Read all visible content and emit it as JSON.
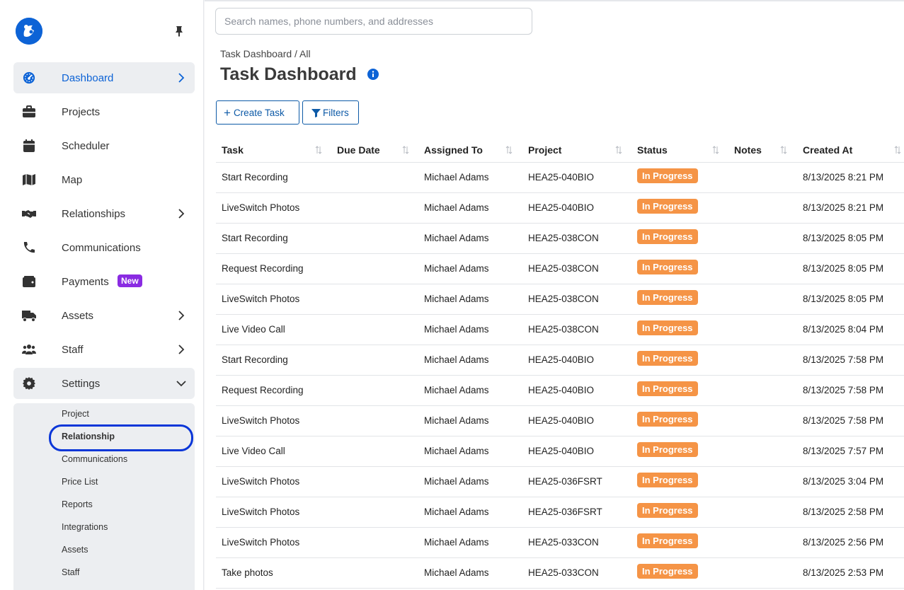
{
  "search": {
    "placeholder": "Search names, phone numbers, and addresses"
  },
  "breadcrumb": "Task Dashboard / All",
  "page_title": "Task Dashboard",
  "buttons": {
    "create_task": "Create Task",
    "filters": "Filters"
  },
  "nav": [
    {
      "label": "Dashboard",
      "icon": "dashboard-gauge-icon",
      "chevron": "right",
      "active": true
    },
    {
      "label": "Projects",
      "icon": "briefcase-icon"
    },
    {
      "label": "Scheduler",
      "icon": "calendar-icon"
    },
    {
      "label": "Map",
      "icon": "map-icon"
    },
    {
      "label": "Relationships",
      "icon": "handshake-icon",
      "chevron": "right"
    },
    {
      "label": "Communications",
      "icon": "phone-icon"
    },
    {
      "label": "Payments",
      "icon": "wallet-icon",
      "badge": "New"
    },
    {
      "label": "Assets",
      "icon": "truck-icon",
      "chevron": "right"
    },
    {
      "label": "Staff",
      "icon": "users-icon",
      "chevron": "right"
    },
    {
      "label": "Settings",
      "icon": "gear-icon",
      "chevron": "down"
    }
  ],
  "settings_sub": [
    "Project",
    "Relationship",
    "Communications",
    "Price List",
    "Reports",
    "Integrations",
    "Assets",
    "Staff"
  ],
  "settings_sub_active": "Relationship",
  "table": {
    "columns": [
      "Task",
      "Due Date",
      "Assigned To",
      "Project",
      "Status",
      "Notes",
      "Created At"
    ],
    "rows": [
      [
        "Start Recording",
        "",
        "Michael Adams",
        "HEA25-040BIO",
        "In Progress",
        "",
        "8/13/2025 8:21 PM"
      ],
      [
        "LiveSwitch Photos",
        "",
        "Michael Adams",
        "HEA25-040BIO",
        "In Progress",
        "",
        "8/13/2025 8:21 PM"
      ],
      [
        "Start Recording",
        "",
        "Michael Adams",
        "HEA25-038CON",
        "In Progress",
        "",
        "8/13/2025 8:05 PM"
      ],
      [
        "Request Recording",
        "",
        "Michael Adams",
        "HEA25-038CON",
        "In Progress",
        "",
        "8/13/2025 8:05 PM"
      ],
      [
        "LiveSwitch Photos",
        "",
        "Michael Adams",
        "HEA25-038CON",
        "In Progress",
        "",
        "8/13/2025 8:05 PM"
      ],
      [
        "Live Video Call",
        "",
        "Michael Adams",
        "HEA25-038CON",
        "In Progress",
        "",
        "8/13/2025 8:04 PM"
      ],
      [
        "Start Recording",
        "",
        "Michael Adams",
        "HEA25-040BIO",
        "In Progress",
        "",
        "8/13/2025 7:58 PM"
      ],
      [
        "Request Recording",
        "",
        "Michael Adams",
        "HEA25-040BIO",
        "In Progress",
        "",
        "8/13/2025 7:58 PM"
      ],
      [
        "LiveSwitch Photos",
        "",
        "Michael Adams",
        "HEA25-040BIO",
        "In Progress",
        "",
        "8/13/2025 7:58 PM"
      ],
      [
        "Live Video Call",
        "",
        "Michael Adams",
        "HEA25-040BIO",
        "In Progress",
        "",
        "8/13/2025 7:57 PM"
      ],
      [
        "LiveSwitch Photos",
        "",
        "Michael Adams",
        "HEA25-036FSRT",
        "In Progress",
        "",
        "8/13/2025 3:04 PM"
      ],
      [
        "LiveSwitch Photos",
        "",
        "Michael Adams",
        "HEA25-036FSRT",
        "In Progress",
        "",
        "8/13/2025 2:58 PM"
      ],
      [
        "LiveSwitch Photos",
        "",
        "Michael Adams",
        "HEA25-033CON",
        "In Progress",
        "",
        "8/13/2025 2:56 PM"
      ],
      [
        "Take photos",
        "",
        "Michael Adams",
        "HEA25-033CON",
        "In Progress",
        "",
        "8/13/2025 2:53 PM"
      ]
    ]
  },
  "colors": {
    "accent": "#0d63d6",
    "status_in_progress": "#f59446",
    "new_badge": "#8a2be2",
    "focus_ring": "#0a36d8"
  }
}
